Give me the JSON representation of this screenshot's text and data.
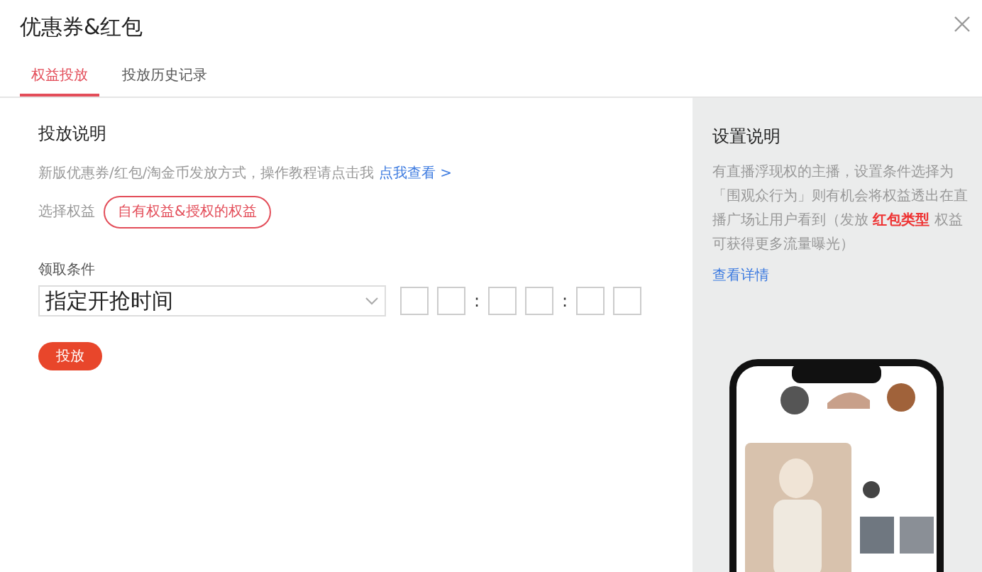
{
  "dialog": {
    "title": "优惠券&红包"
  },
  "tabs": [
    {
      "label": "权益投放",
      "selected": true
    },
    {
      "label": "投放历史记录",
      "selected": false
    }
  ],
  "section": {
    "title": "投放说明",
    "description": "新版优惠券/红包/淘金币发放方式，操作教程请点击我",
    "link": "点我查看 >"
  },
  "benefit": {
    "label": "选择权益",
    "button": "自有权益&授权的权益"
  },
  "condition": {
    "label": "领取条件",
    "value": "指定开抢时间"
  },
  "time_inputs": [
    {
      "kind": "digit"
    },
    {
      "kind": "digit"
    },
    {
      "kind": "separator",
      "text": ":"
    },
    {
      "kind": "digit"
    },
    {
      "kind": "digit"
    },
    {
      "kind": "separator",
      "text": ":"
    },
    {
      "kind": "digit"
    },
    {
      "kind": "digit"
    }
  ],
  "submit": "投放",
  "help": {
    "title": "设置说明",
    "text": "有直播浮现权的主播，设置条件选择为「围观众行为」则有机会将权益透出在直播广场让用户看到（发放 **红包类型** 权益可获得更多流量曝光）",
    "link": "查看详情"
  }
}
